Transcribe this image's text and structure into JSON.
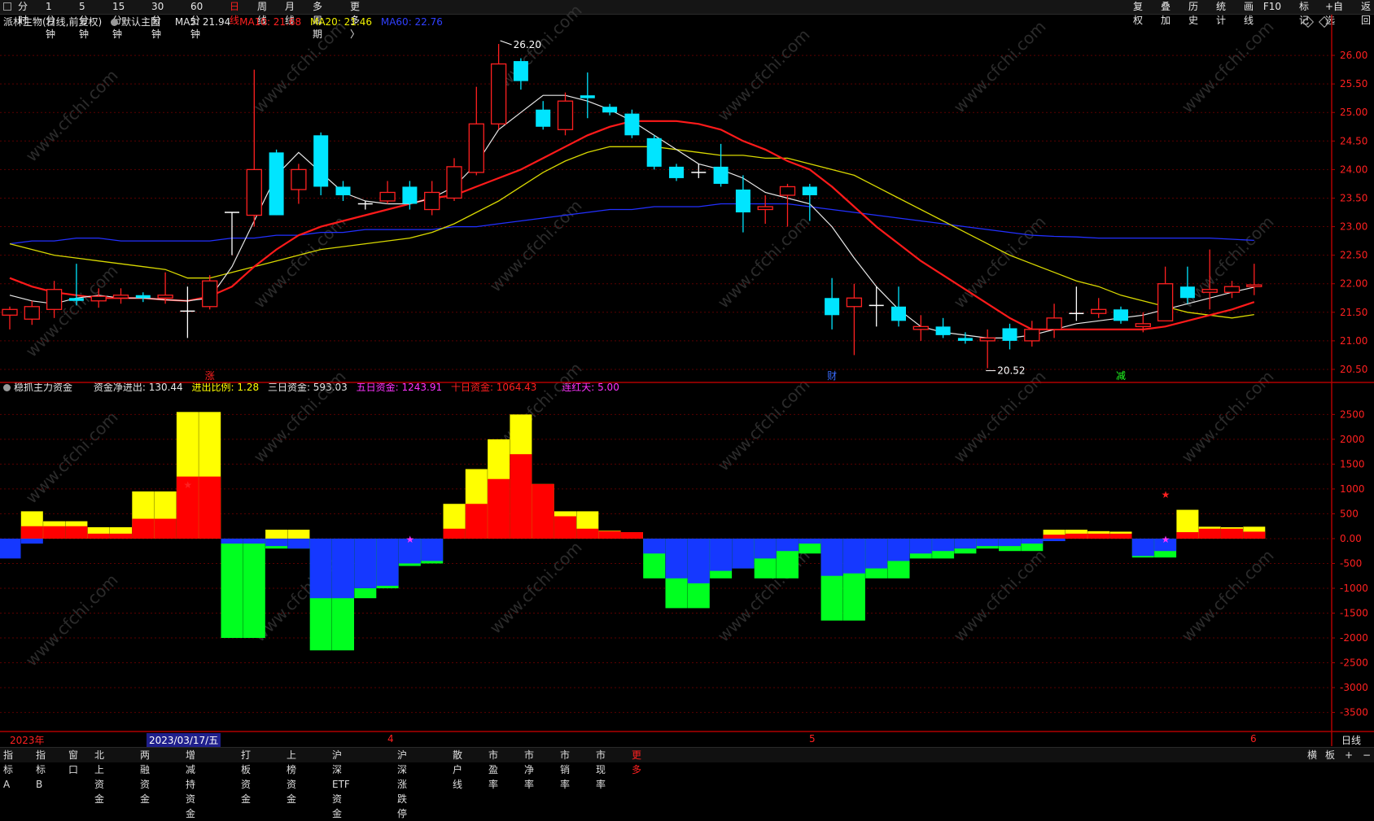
{
  "toolbar": {
    "periods": [
      "分时",
      "1分钟",
      "5分钟",
      "15分钟",
      "30分钟",
      "60分钟",
      "日线",
      "周线",
      "月线",
      "多周期",
      "更多 〉"
    ],
    "active_period": "日线",
    "right_buttons": [
      "复权",
      "叠加",
      "历史",
      "统计",
      "画线",
      "F10",
      "标记",
      "+自选",
      "返回"
    ]
  },
  "main_legend": {
    "stock_name": "派林生物(日线,前复权)",
    "main_chart": "默认主图",
    "ma5": "MA5: 21.94",
    "ma10": "MA10: 21.68",
    "ma20": "MA20: 21.46",
    "ma60": "MA60: 22.76"
  },
  "sub_legend": {
    "indicator": "稳抓主力资金",
    "net": "资金净进出: 130.44",
    "ratio": "进出比例: 1.28",
    "three_day": "三日资金: 593.03",
    "five_day": "五日资金: 1243.91",
    "ten_day": "十日资金: 1064.43",
    "red_days": "连红天: 5.00"
  },
  "colors": {
    "up": "#ff2020",
    "down": "#00e5ff",
    "ma5": "#e8e8e8",
    "ma10": "#ff1a1a",
    "ma20": "#d8d800",
    "ma60": "#2230ff",
    "yellow": "#ffff00",
    "green": "#00ff20",
    "blue": "#1538ff",
    "axis": "#b00000"
  },
  "price_axis": [
    "26.00",
    "25.50",
    "25.00",
    "24.50",
    "24.00",
    "23.50",
    "23.00",
    "22.50",
    "22.00",
    "21.50",
    "21.00",
    "20.50"
  ],
  "fund_axis": [
    "2500",
    "2000",
    "1500",
    "1000",
    "500",
    "0.00",
    "-500",
    "-1000",
    "-1500",
    "-2000",
    "-2500",
    "-3000",
    "-3500"
  ],
  "annotations": {
    "high": "26.20",
    "low": "20.52"
  },
  "markers": {
    "zhang": "涨",
    "cai": "财",
    "jian": "减"
  },
  "date_labels": {
    "year": "2023年",
    "cursor": "2023/03/17/五",
    "m4": "4",
    "m5": "5",
    "m6": "6",
    "period": "日线"
  },
  "bottom_tabs": [
    "指标A",
    "指标B",
    "窗口",
    "北上资金",
    "两融资金",
    "增减持资金",
    "打板资金",
    "上榜资金",
    "沪深ETF资金",
    "沪深涨跌停",
    "散户线",
    "市盈率",
    "市净率",
    "市销率",
    "市现率",
    "更多"
  ],
  "bottom_right": [
    "横",
    "板",
    "+",
    "−"
  ],
  "watermark": "www.cfchi.com",
  "chart_data": [
    {
      "type": "candlestick",
      "title": "派林生物(日线,前复权)",
      "ylim": [
        20.3,
        26.4
      ],
      "candles": [
        [
          21.45,
          21.55,
          21.2,
          21.6
        ],
        [
          21.38,
          21.6,
          21.28,
          21.7
        ],
        [
          21.55,
          21.9,
          21.4,
          22.05
        ],
        [
          21.75,
          21.7,
          21.62,
          22.35
        ],
        [
          21.7,
          21.78,
          21.58,
          21.92
        ],
        [
          21.75,
          21.8,
          21.65,
          21.92
        ],
        [
          21.8,
          21.75,
          21.68,
          21.85
        ],
        [
          21.75,
          21.8,
          21.65,
          22.2
        ],
        [
          21.52,
          21.52,
          21.05,
          21.95
        ],
        [
          21.6,
          22.05,
          21.55,
          22.15
        ],
        [
          23.25,
          23.25,
          22.5,
          23.25
        ],
        [
          23.2,
          24.0,
          23.0,
          25.75
        ],
        [
          24.3,
          23.2,
          23.2,
          24.35
        ],
        [
          23.65,
          24.0,
          23.4,
          24.1
        ],
        [
          24.6,
          23.7,
          23.55,
          24.65
        ],
        [
          23.7,
          23.55,
          23.45,
          23.8
        ],
        [
          23.38,
          23.4,
          23.3,
          23.45
        ],
        [
          23.45,
          23.6,
          23.4,
          23.8
        ],
        [
          23.7,
          23.4,
          23.3,
          23.8
        ],
        [
          23.3,
          23.6,
          23.2,
          23.8
        ],
        [
          23.5,
          24.05,
          23.45,
          24.2
        ],
        [
          23.95,
          24.8,
          23.9,
          25.45
        ],
        [
          24.8,
          25.85,
          24.7,
          26.2
        ],
        [
          25.9,
          25.55,
          25.4,
          25.95
        ],
        [
          25.05,
          24.75,
          24.7,
          25.2
        ],
        [
          24.7,
          25.2,
          24.6,
          25.35
        ],
        [
          25.3,
          25.25,
          24.9,
          25.7
        ],
        [
          25.1,
          25.0,
          24.95,
          25.15
        ],
        [
          24.98,
          24.6,
          24.55,
          25.05
        ],
        [
          24.55,
          24.05,
          24.0,
          24.6
        ],
        [
          24.05,
          23.85,
          23.8,
          24.1
        ],
        [
          23.95,
          23.95,
          23.85,
          24.1
        ],
        [
          24.05,
          23.75,
          23.7,
          24.45
        ],
        [
          23.65,
          23.25,
          22.9,
          23.9
        ],
        [
          23.3,
          23.35,
          23.05,
          23.55
        ],
        [
          23.55,
          23.7,
          23.0,
          23.75
        ],
        [
          23.7,
          23.55,
          23.1,
          23.75
        ],
        [
          21.75,
          21.45,
          21.2,
          22.1
        ],
        [
          21.6,
          21.75,
          20.75,
          22.0
        ],
        [
          21.62,
          21.62,
          21.25,
          21.95
        ],
        [
          21.6,
          21.35,
          21.25,
          21.95
        ],
        [
          21.2,
          21.25,
          21.0,
          21.45
        ],
        [
          21.25,
          21.1,
          21.05,
          21.4
        ],
        [
          21.05,
          21.0,
          20.95,
          21.15
        ],
        [
          21.0,
          21.05,
          20.52,
          21.2
        ],
        [
          21.22,
          21.0,
          20.85,
          21.3
        ],
        [
          21.0,
          21.2,
          20.9,
          21.35
        ],
        [
          21.2,
          21.4,
          21.05,
          21.65
        ],
        [
          21.48,
          21.48,
          21.35,
          21.95
        ],
        [
          21.48,
          21.55,
          21.4,
          21.75
        ],
        [
          21.55,
          21.35,
          21.3,
          21.6
        ],
        [
          21.25,
          21.3,
          21.15,
          21.5
        ],
        [
          21.35,
          22.0,
          21.35,
          22.3
        ],
        [
          21.95,
          21.75,
          21.65,
          22.3
        ],
        [
          21.85,
          21.9,
          21.55,
          22.6
        ],
        [
          21.85,
          21.95,
          21.75,
          22.05
        ],
        [
          21.95,
          21.98,
          21.8,
          22.35
        ]
      ],
      "ma5": [
        21.8,
        21.7,
        21.65,
        21.75,
        21.8,
        21.75,
        21.75,
        21.72,
        21.7,
        21.75,
        22.3,
        23.1,
        23.9,
        24.3,
        23.95,
        23.6,
        23.45,
        23.4,
        23.4,
        23.5,
        23.7,
        24.1,
        24.7,
        25.0,
        25.3,
        25.3,
        25.2,
        25.05,
        24.85,
        24.6,
        24.35,
        24.1,
        24.0,
        23.85,
        23.6,
        23.5,
        23.4,
        23.0,
        22.45,
        21.95,
        21.55,
        21.25,
        21.15,
        21.1,
        21.05,
        21.05,
        21.1,
        21.2,
        21.3,
        21.35,
        21.4,
        21.45,
        21.55,
        21.65,
        21.75,
        21.85,
        21.94
      ],
      "ma10": [
        22.1,
        21.95,
        21.85,
        21.8,
        21.75,
        21.75,
        21.75,
        21.72,
        21.7,
        21.78,
        21.95,
        22.3,
        22.6,
        22.85,
        23.0,
        23.1,
        23.2,
        23.3,
        23.4,
        23.5,
        23.55,
        23.7,
        23.85,
        24.0,
        24.2,
        24.4,
        24.6,
        24.75,
        24.85,
        24.85,
        24.85,
        24.8,
        24.7,
        24.5,
        24.35,
        24.15,
        24.0,
        23.7,
        23.35,
        23.0,
        22.7,
        22.4,
        22.15,
        21.9,
        21.65,
        21.4,
        21.2,
        21.2,
        21.2,
        21.2,
        21.2,
        21.2,
        21.25,
        21.35,
        21.45,
        21.55,
        21.68
      ],
      "ma20": [
        22.7,
        22.6,
        22.5,
        22.45,
        22.4,
        22.35,
        22.3,
        22.25,
        22.1,
        22.1,
        22.2,
        22.3,
        22.4,
        22.5,
        22.6,
        22.65,
        22.7,
        22.75,
        22.8,
        22.9,
        23.05,
        23.25,
        23.45,
        23.7,
        23.95,
        24.15,
        24.3,
        24.4,
        24.4,
        24.4,
        24.35,
        24.3,
        24.25,
        24.25,
        24.2,
        24.2,
        24.1,
        24.0,
        23.9,
        23.7,
        23.5,
        23.3,
        23.1,
        22.9,
        22.7,
        22.5,
        22.35,
        22.2,
        22.05,
        21.95,
        21.8,
        21.7,
        21.6,
        21.5,
        21.45,
        21.4,
        21.46
      ],
      "ma60": [
        22.7,
        22.75,
        22.75,
        22.8,
        22.8,
        22.75,
        22.75,
        22.75,
        22.75,
        22.75,
        22.8,
        22.8,
        22.85,
        22.85,
        22.9,
        22.9,
        22.95,
        22.95,
        22.95,
        22.95,
        23.0,
        23.0,
        23.05,
        23.1,
        23.15,
        23.2,
        23.25,
        23.3,
        23.3,
        23.35,
        23.35,
        23.35,
        23.4,
        23.4,
        23.4,
        23.4,
        23.35,
        23.3,
        23.25,
        23.2,
        23.15,
        23.1,
        23.05,
        23.0,
        22.95,
        22.9,
        22.85,
        22.83,
        22.82,
        22.8,
        22.8,
        22.8,
        22.8,
        22.8,
        22.8,
        22.78,
        22.76
      ]
    },
    {
      "type": "bar",
      "title": "稳抓主力资金",
      "ylim": [
        -3900,
        2850
      ],
      "series": [
        {
          "name": "资金净进出",
          "color": "#1538ff",
          "values": [
            -400,
            -100,
            0,
            0,
            0,
            0,
            0,
            0,
            0,
            0,
            -100,
            -100,
            -150,
            -200,
            -1200,
            -1200,
            -1000,
            -950,
            -500,
            -450,
            0,
            0,
            0,
            0,
            0,
            0,
            0,
            0,
            0,
            -300,
            -800,
            -900,
            -650,
            -600,
            -400,
            -250,
            -100,
            -750,
            -700,
            -600,
            -450,
            -300,
            -250,
            -200,
            -150,
            -150,
            -100,
            -50,
            0,
            0,
            0,
            -350,
            -250,
            0,
            0,
            0,
            0
          ]
        },
        {
          "name": "流出",
          "color": "#00ff20",
          "values": [
            0,
            0,
            0,
            0,
            0,
            0,
            0,
            0,
            0,
            0,
            -2000,
            -2000,
            -200,
            -200,
            -2250,
            -2250,
            -1200,
            -1000,
            -550,
            -500,
            0,
            0,
            0,
            0,
            0,
            0,
            0,
            0,
            0,
            -800,
            -1400,
            -1400,
            -800,
            -600,
            -800,
            -800,
            -300,
            -1650,
            -1650,
            -800,
            -800,
            -400,
            -400,
            -300,
            -200,
            -250,
            -250,
            -50,
            0,
            0,
            0,
            -380,
            -380,
            0,
            0,
            0,
            0
          ]
        },
        {
          "name": "流入",
          "color": "#ff0000",
          "values": [
            0,
            250,
            250,
            250,
            100,
            100,
            400,
            400,
            1250,
            1250,
            0,
            0,
            0,
            0,
            0,
            0,
            0,
            0,
            0,
            0,
            200,
            700,
            1200,
            1700,
            1100,
            450,
            200,
            150,
            130,
            0,
            0,
            0,
            0,
            0,
            0,
            0,
            0,
            0,
            0,
            0,
            0,
            0,
            0,
            0,
            0,
            0,
            0,
            80,
            100,
            100,
            100,
            0,
            0,
            130,
            200,
            200,
            140
          ]
        },
        {
          "name": "强度",
          "color": "#ffff00",
          "values": [
            0,
            550,
            350,
            350,
            230,
            230,
            950,
            950,
            2550,
            2550,
            0,
            0,
            180,
            180,
            0,
            0,
            0,
            0,
            0,
            0,
            700,
            1400,
            2000,
            2500,
            1100,
            550,
            550,
            160,
            130,
            0,
            0,
            0,
            0,
            0,
            0,
            0,
            0,
            0,
            0,
            0,
            0,
            0,
            0,
            0,
            0,
            0,
            0,
            180,
            180,
            150,
            140,
            0,
            0,
            580,
            240,
            230,
            240
          ]
        }
      ],
      "stars": [
        {
          "i": 8,
          "v": 1100,
          "color": "#ff2020"
        },
        {
          "i": 18,
          "v": 0,
          "color": "#ff33ff"
        },
        {
          "i": 52,
          "v": 900,
          "color": "#ff2020"
        },
        {
          "i": 52,
          "v": 0,
          "color": "#ff33ff"
        }
      ]
    }
  ]
}
